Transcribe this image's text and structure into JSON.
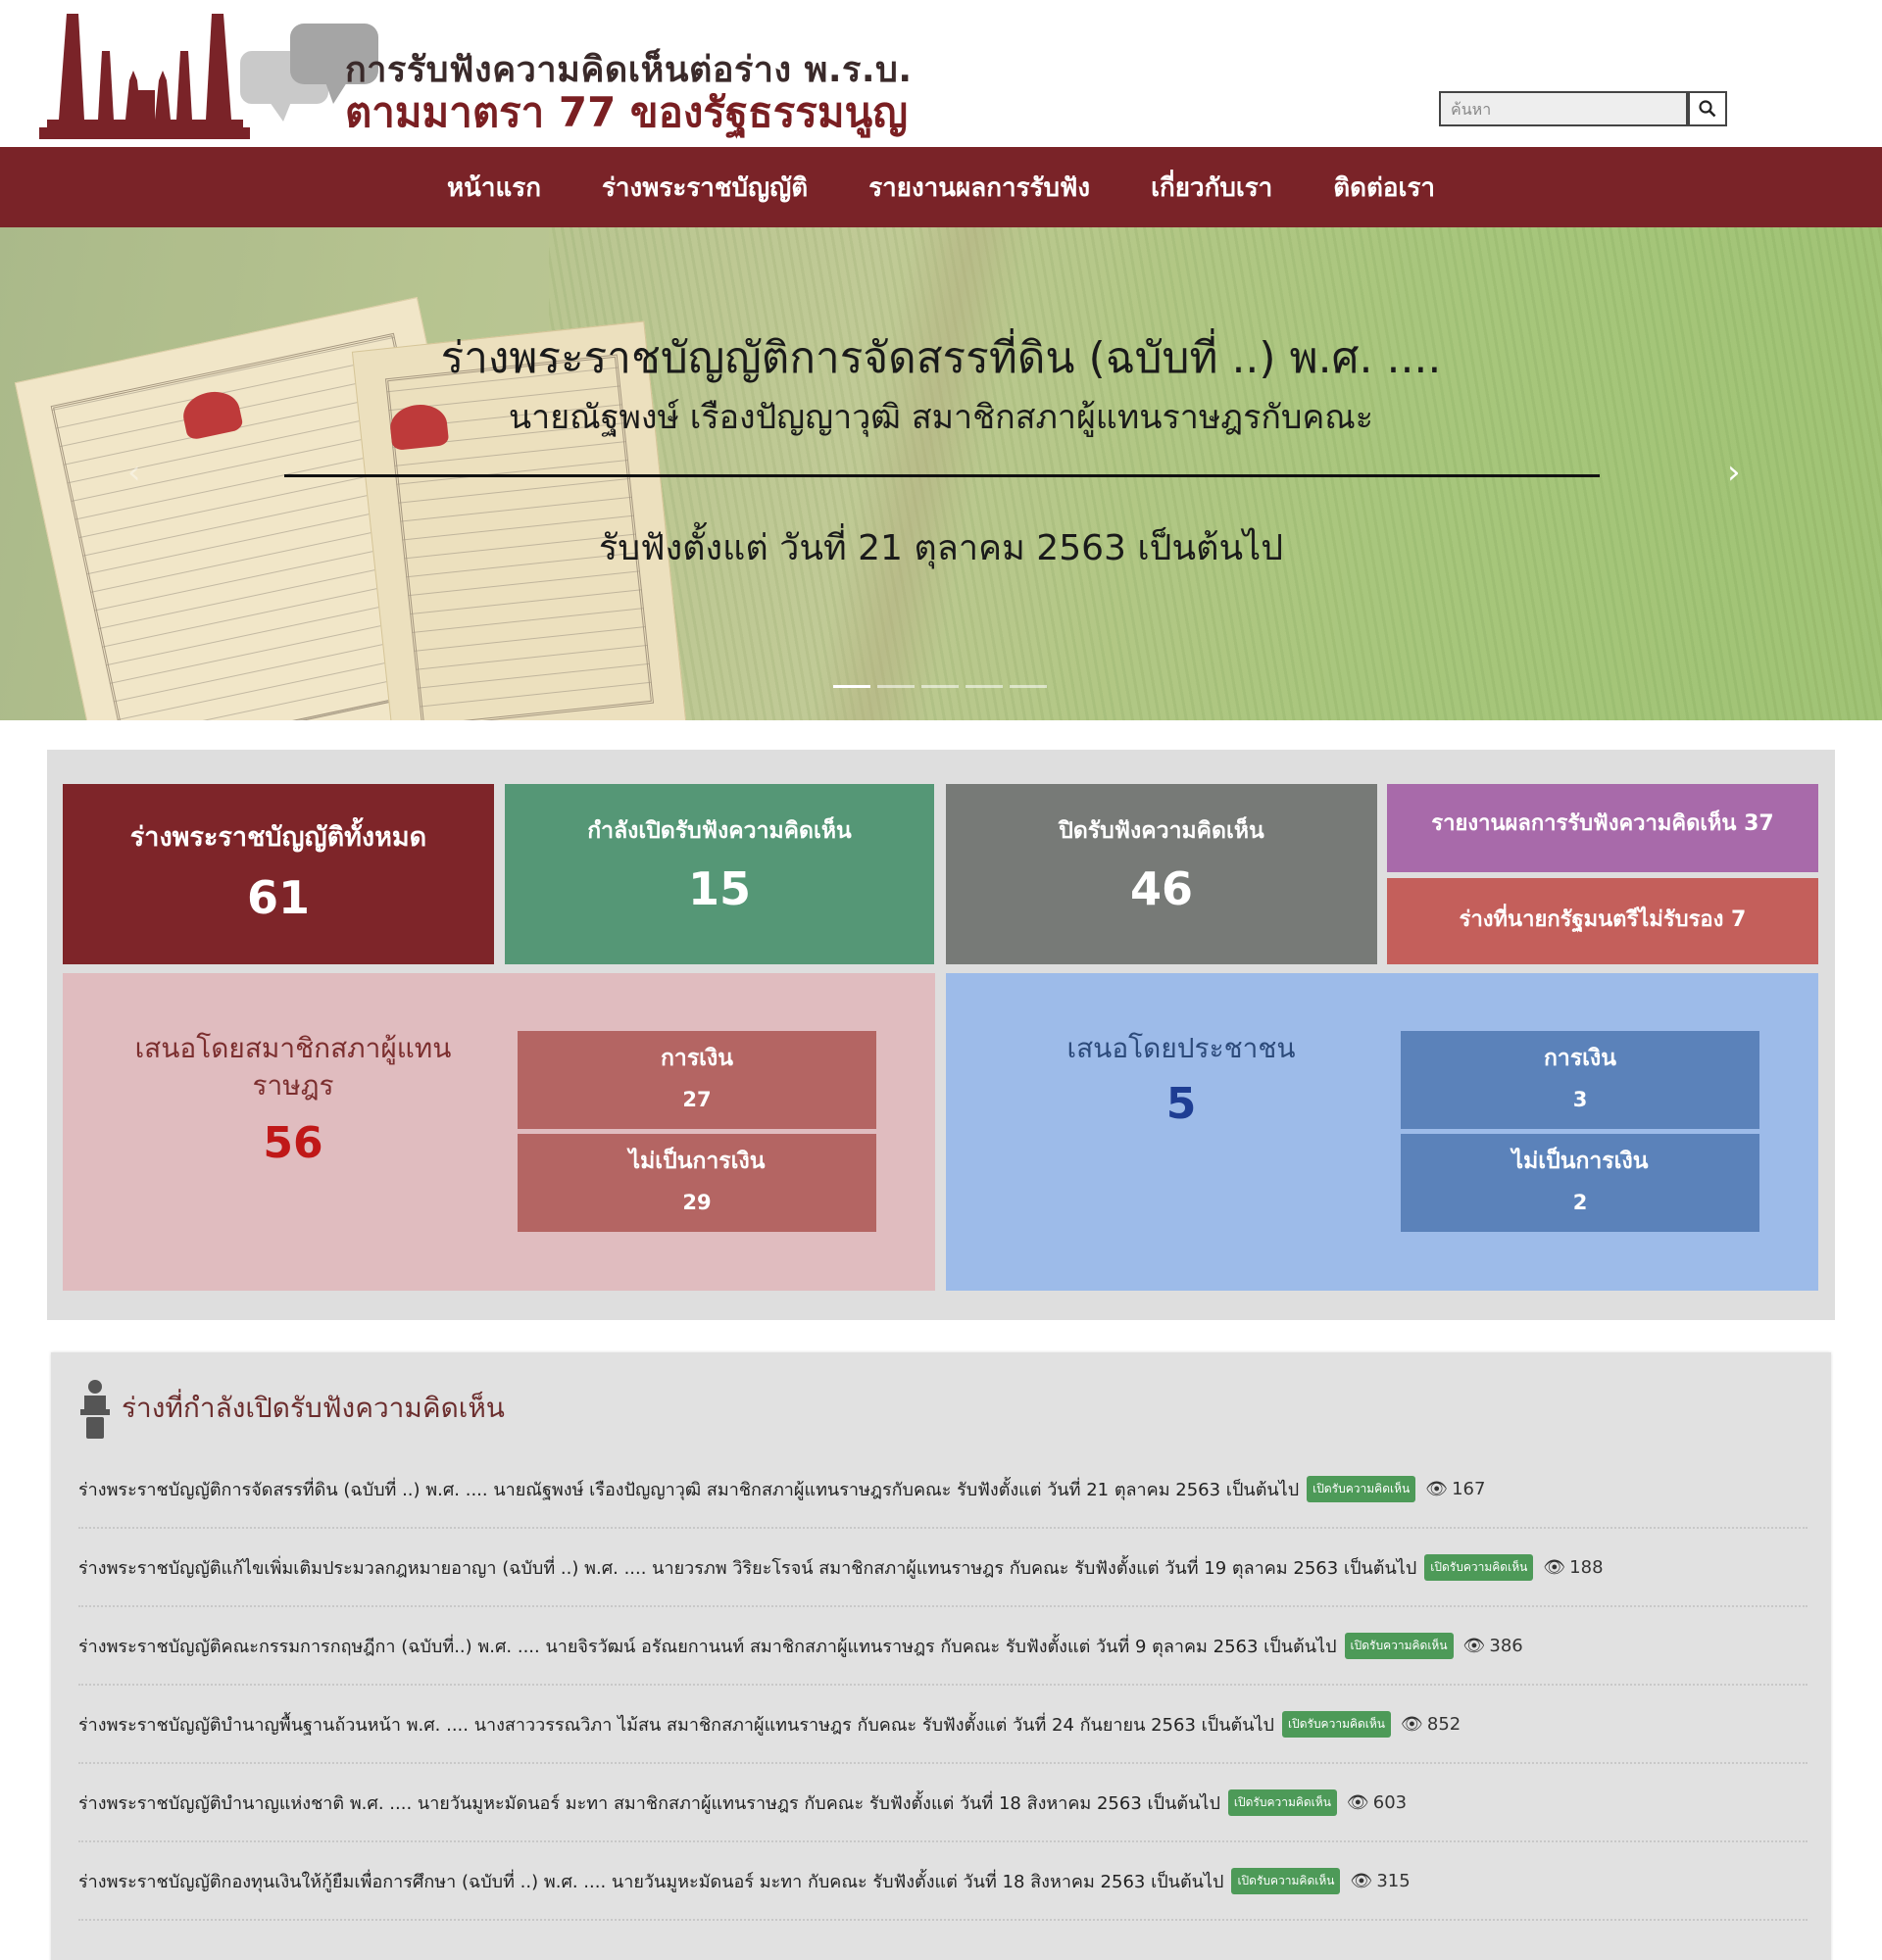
{
  "site": {
    "title_line1": "การรับฟังความคิดเห็นต่อร่าง พ.ร.บ.",
    "title_line2": "ตามมาตรา 77 ของรัฐธรรมนูญ",
    "search_placeholder": "ค้นหา"
  },
  "nav": [
    "หน้าแรก",
    "ร่างพระราชบัญญัติ",
    "รายงานผลการรับฟัง",
    "เกี่ยวกับเรา",
    "ติดต่อเรา"
  ],
  "hero": {
    "title": "ร่างพระราชบัญญัติการจัดสรรที่ดิน (ฉบับที่ ..) พ.ศ. ....",
    "subtitle": "นายณัฐพงษ์ เรืองปัญญาวุฒิ สมาชิกสภาผู้แทนราษฎรกับคณะ",
    "date": "รับฟังตั้งแต่ วันที่ 21 ตุลาคม 2563 เป็นต้นไป",
    "slide_count": 5,
    "active_slide": 1
  },
  "stats": {
    "total_label": "ร่างพระราชบัญญัติทั้งหมด",
    "total": "61",
    "open_label": "กำลังเปิดรับฟังความคิดเห็น",
    "open": "15",
    "closed_label": "ปิดรับฟังความคิดเห็น",
    "closed": "46",
    "report_label": "รายงานผลการรับฟังความคิดเห็น 37",
    "rejected_label": "ร่างที่นายกรัฐมนตรีไม่รับรอง 7",
    "mp": {
      "title": "เสนอโดยสมาชิกสภาผู้แทนราษฎร",
      "total": "56",
      "finance_label": "การเงิน",
      "finance": "27",
      "nonfinance_label": "ไม่เป็นการเงิน",
      "nonfinance": "29"
    },
    "people": {
      "title": "เสนอโดยประชาชน",
      "total": "5",
      "finance_label": "การเงิน",
      "finance": "3",
      "nonfinance_label": "ไม่เป็นการเงิน",
      "nonfinance": "2"
    }
  },
  "open_list": {
    "title": "ร่างที่กำลังเปิดรับฟังความคิดเห็น",
    "badge": "เปิดรับความคิดเห็น",
    "items": [
      {
        "text": "ร่างพระราชบัญญัติการจัดสรรที่ดิน (ฉบับที่ ..) พ.ศ. .... นายณัฐพงษ์ เรืองปัญญาวุฒิ สมาชิกสภาผู้แทนราษฎรกับคณะ รับฟังตั้งแต่ วันที่ 21 ตุลาคม 2563 เป็นต้นไป",
        "views": "167"
      },
      {
        "text": "ร่างพระราชบัญญัติแก้ไขเพิ่มเติมประมวลกฎหมายอาญา (ฉบับที่ ..) พ.ศ. .... นายวรภพ วิริยะโรจน์ สมาชิกสภาผู้แทนราษฎร กับคณะ รับฟังตั้งแต่ วันที่ 19 ตุลาคม 2563 เป็นต้นไป",
        "views": "188"
      },
      {
        "text": "ร่างพระราชบัญญัติคณะกรรมการกฤษฎีกา (ฉบับที่..) พ.ศ. .... นายจิรวัฒน์ อรัณยกานนท์ สมาชิกสภาผู้แทนราษฎร กับคณะ รับฟังตั้งแต่ วันที่ 9 ตุลาคม 2563 เป็นต้นไป",
        "views": "386"
      },
      {
        "text": "ร่างพระราชบัญญัติบำนาญพื้นฐานถ้วนหน้า พ.ศ. .... นางสาววรรณวิภา ไม้สน สมาชิกสภาผู้แทนราษฎร กับคณะ รับฟังตั้งแต่ วันที่ 24 กันยายน 2563 เป็นต้นไป",
        "views": "852"
      },
      {
        "text": "ร่างพระราชบัญญัติบำนาญแห่งชาติ พ.ศ. .... นายวันมูหะมัดนอร์ มะทา สมาชิกสภาผู้แทนราษฎร กับคณะ รับฟังตั้งแต่ วันที่ 18 สิงหาคม 2563 เป็นต้นไป",
        "views": "603"
      },
      {
        "text": "ร่างพระราชบัญญัติกองทุนเงินให้กู้ยืมเพื่อการศึกษา (ฉบับที่ ..) พ.ศ. .... นายวันมูหะมัดนอร์ มะทา กับคณะ รับฟังตั้งแต่ วันที่ 18 สิงหาคม 2563 เป็นต้นไป",
        "views": "315"
      }
    ]
  },
  "colors": {
    "brand": "#7a2328",
    "open": "#559776",
    "closed": "#777a77",
    "report": "#a86aaa",
    "rejected": "#c45f5b",
    "badge": "#4d9a58"
  }
}
